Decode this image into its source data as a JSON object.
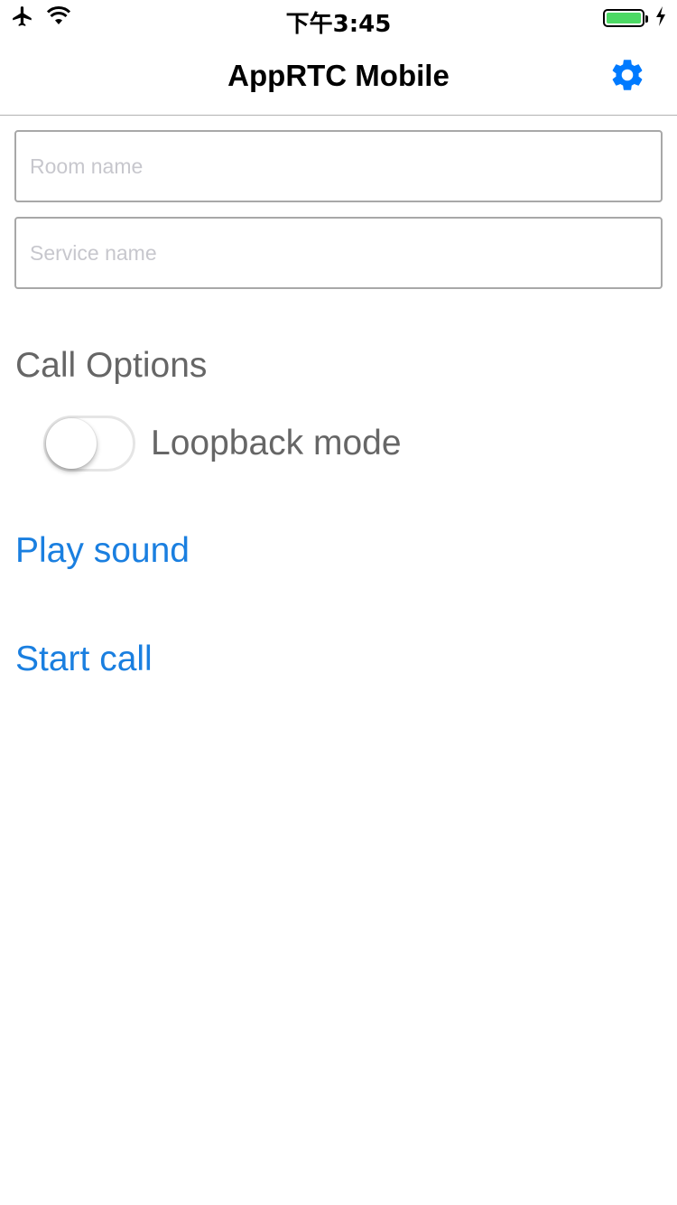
{
  "status_bar": {
    "time": "下午3:45",
    "battery_color": "#4cd964"
  },
  "nav": {
    "title": "AppRTC Mobile",
    "accent_color": "#007aff"
  },
  "form": {
    "room_placeholder": "Room name",
    "room_value": "",
    "service_placeholder": "Service name",
    "service_value": ""
  },
  "call_options": {
    "title": "Call Options",
    "loopback_label": "Loopback mode",
    "loopback_on": false
  },
  "actions": {
    "play_sound": "Play sound",
    "start_call": "Start call",
    "link_color": "#1a7fe0"
  },
  "icons": {
    "airplane": "airplane-icon",
    "wifi": "wifi-icon",
    "battery": "battery-icon",
    "charging": "charging-icon",
    "settings": "gear-icon"
  }
}
